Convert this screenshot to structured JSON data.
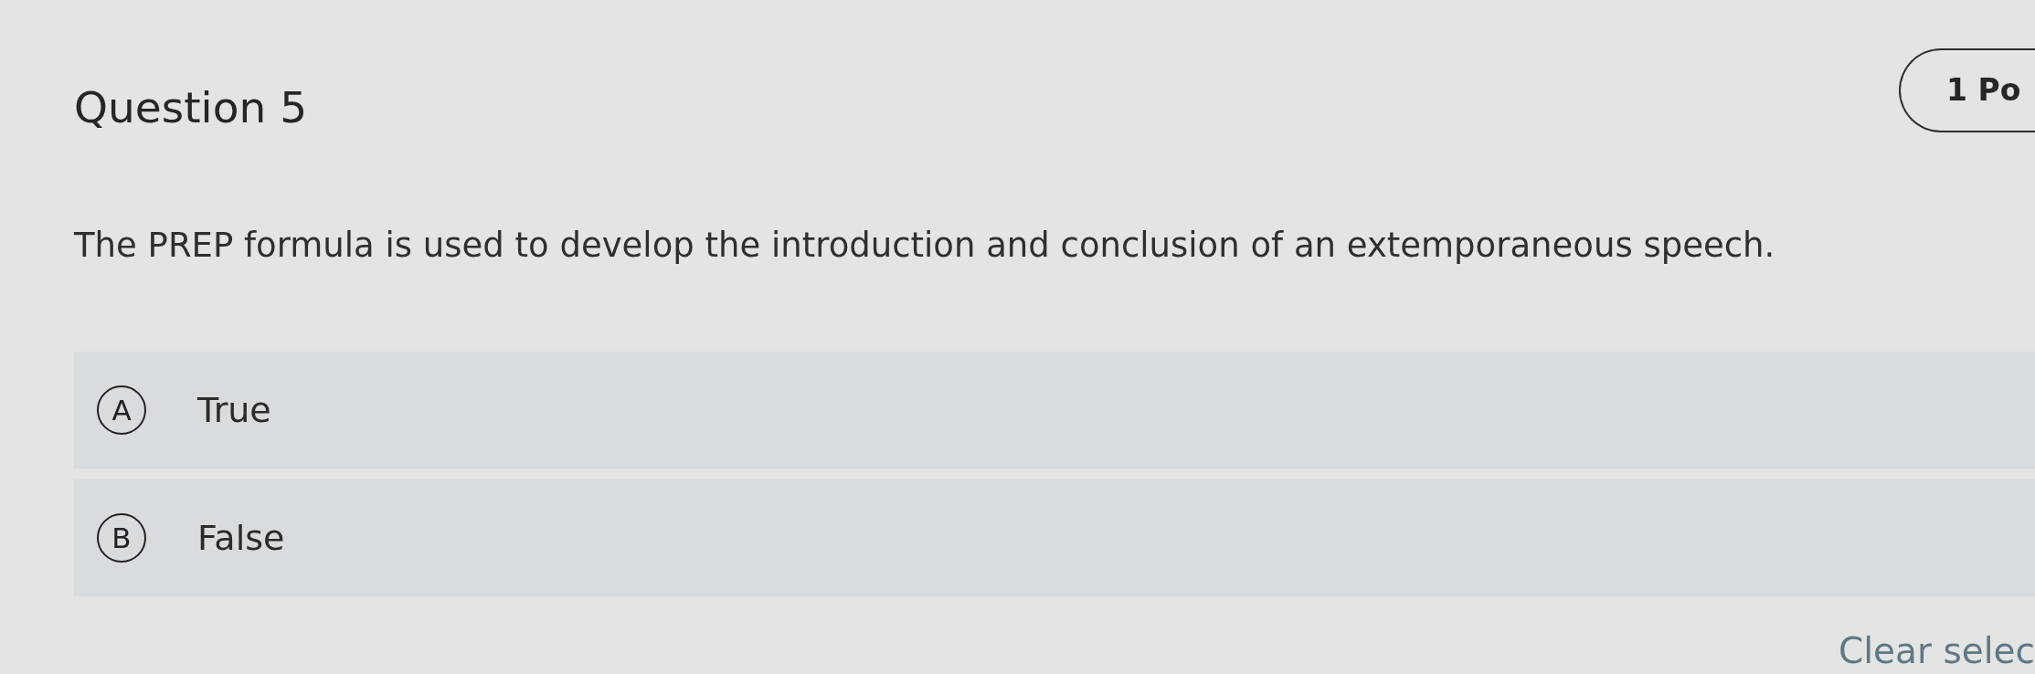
{
  "question": {
    "title": "Question 5",
    "points": "1 Po",
    "prompt": "The PREP formula is used to develop the introduction and conclusion of an extemporaneous speech."
  },
  "options": [
    {
      "letter": "A",
      "label": "True",
      "selected": false
    },
    {
      "letter": "B",
      "label": "False",
      "selected": false
    }
  ],
  "clear_selection": "Clear selec"
}
